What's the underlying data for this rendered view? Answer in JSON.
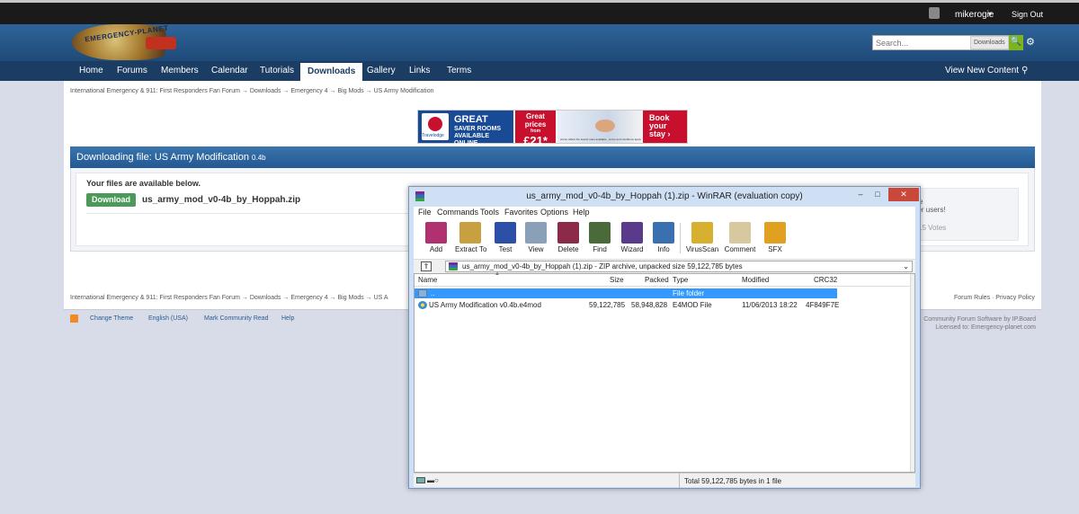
{
  "userbar": {
    "username": "mikerogie",
    "caret": "▾",
    "signout": "Sign Out"
  },
  "branding": {
    "logo_text": "EMERGENCY-PLANET",
    "search_placeholder": "Search...",
    "search_scope": "Downloads",
    "search_icon": "🔍",
    "settings_icon": "⚙"
  },
  "nav": {
    "tabs": [
      {
        "label": "Home"
      },
      {
        "label": "Forums"
      },
      {
        "label": "Members"
      },
      {
        "label": "Calendar"
      },
      {
        "label": "Tutorials"
      },
      {
        "label": "Downloads"
      },
      {
        "label": "Gallery"
      },
      {
        "label": "Links"
      },
      {
        "label": "Terms"
      }
    ],
    "active_tab": "Downloads",
    "view_new": "View New Content",
    "pin_icon": "⚲"
  },
  "breadcrumb": "International Emergency & 911: First Responders Fan Forum → Downloads → Emergency 4 → Big Mods → US Army Modification",
  "breadcrumb_bottom": "International Emergency & 911: First Responders Fan Forum → Downloads → Emergency 4 → Big Mods → US A",
  "ad": {
    "brand": "Travelodge",
    "headline": "GREAT",
    "subline1": "SAVER ROOMS",
    "subline2": "AVAILABLE ONLINE",
    "price_a": "Great",
    "price_b": "prices",
    "price_c": "from",
    "price_d": "£21*",
    "fineprint": "prices reflect the lowest rates available · terms and conditions apply",
    "cta1": "Book",
    "cta2": "your",
    "cta3": "stay ›"
  },
  "download": {
    "heading": "Downloading file: US Army Modification",
    "version": "0.4b",
    "available": "Your files are available below.",
    "button": "Download",
    "filename": "us_army_mod_v0-4b_by_Hoppah.zip",
    "rate_e": "e",
    "rate_users": "her users!",
    "rate_votes": "15 Votes"
  },
  "footer": {
    "links": [
      "Change Theme",
      "English (USA)",
      "Mark Community Read",
      "Help"
    ],
    "rules": "Forum Rules · Privacy Policy",
    "powered1": "Community Forum Software by IP.Board",
    "powered2": "Licensed to: Emergency-planet.com"
  },
  "winrar": {
    "title": "us_army_mod_v0-4b_by_Hoppah (1).zip - WinRAR (evaluation copy)",
    "min": "–",
    "max": "□",
    "close": "✕",
    "menu": [
      "File",
      "Commands",
      "Tools",
      "Favorites",
      "Options",
      "Help"
    ],
    "tools": [
      {
        "label": "Add",
        "color": "#b03070"
      },
      {
        "label": "Extract To",
        "color": "#c8a040"
      },
      {
        "label": "Test",
        "color": "#2c4fa8"
      },
      {
        "label": "View",
        "color": "#8aa0b8"
      },
      {
        "label": "Delete",
        "color": "#8c2a4a"
      },
      {
        "label": "Find",
        "color": "#4a6a3a"
      },
      {
        "label": "Wizard",
        "color": "#5a3a8a"
      },
      {
        "label": "Info",
        "color": "#3a70b0"
      },
      {
        "label": "VirusScan",
        "color": "#d8b030"
      },
      {
        "label": "Comment",
        "color": "#d8c8a0"
      },
      {
        "label": "SFX",
        "color": "#e0a020"
      }
    ],
    "up_icon": "⇑",
    "path": "us_army_mod_v0-4b_by_Hoppah (1).zip - ZIP archive, unpacked size 59,122,785 bytes",
    "dropdown": "⌄",
    "columns": [
      "Name",
      "Size",
      "Packed",
      "Type",
      "Modified",
      "CRC32"
    ],
    "sort_arrow": "▲",
    "rows": [
      {
        "name": "..",
        "size": "",
        "packed": "",
        "type": "File folder",
        "modified": "",
        "crc": ""
      },
      {
        "name": "US Army Modification v0.4b.e4mod",
        "size": "59,122,785",
        "packed": "58,948,828",
        "type": "E4MOD File",
        "modified": "11/06/2013 18:22",
        "crc": "4F849F7E"
      }
    ],
    "status_key": "▬○",
    "status_total": "Total 59,122,785 bytes in 1 file"
  }
}
